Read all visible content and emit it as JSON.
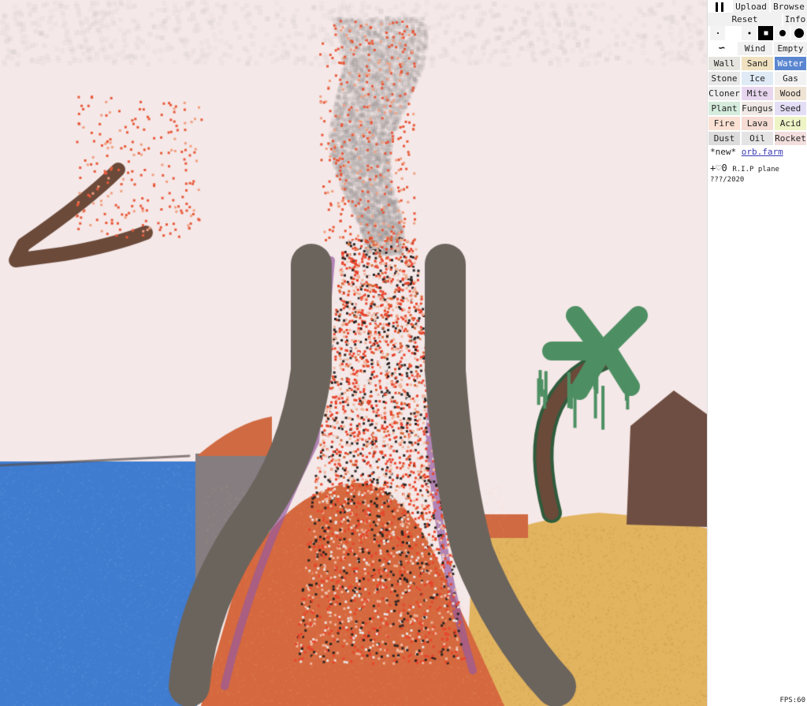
{
  "toolbar": {
    "pause_icon": "pause-icon",
    "upload": "Upload",
    "browse": "Browse",
    "reset": "Reset",
    "info": "Info",
    "wind": "Wind",
    "empty": "Empty",
    "brush_sizes": [
      "1",
      "2",
      "3",
      "4",
      "5"
    ],
    "selected_brush_index": 2
  },
  "elements": [
    {
      "label": "Wall",
      "color": "#e6e4de"
    },
    {
      "label": "Sand",
      "color": "#f0e2c0"
    },
    {
      "label": "Water",
      "color": "#5a86d0",
      "text": "#ffffff"
    },
    {
      "label": "Stone",
      "color": "#e8e8e8"
    },
    {
      "label": "Ice",
      "color": "#dfeaf6"
    },
    {
      "label": "Gas",
      "color": "#f2f2f2"
    },
    {
      "label": "Cloner",
      "color": "#eeeeee"
    },
    {
      "label": "Mite",
      "color": "#e8d6ef"
    },
    {
      "label": "Wood",
      "color": "#efe3d4"
    },
    {
      "label": "Plant",
      "color": "#d6ecdc"
    },
    {
      "label": "Fungus",
      "color": "#efe8e4"
    },
    {
      "label": "Seed",
      "color": "#e3def5"
    },
    {
      "label": "Fire",
      "color": "#fbe1d4"
    },
    {
      "label": "Lava",
      "color": "#f6dcd4"
    },
    {
      "label": "Acid",
      "color": "#eef4c6"
    },
    {
      "label": "Dust",
      "color": "#dcdcdc"
    },
    {
      "label": "Oil",
      "color": "#e4e4e4"
    },
    {
      "label": "Rocket",
      "color": "#f3dede"
    }
  ],
  "feed": {
    "new_tag": "*new*",
    "link": "orb.farm",
    "likes": "+♡0",
    "post_title": "R.I.P plane",
    "date": "???/2020"
  },
  "fps": "FPS:60",
  "colors": {
    "sky": "#f5e8e8",
    "smoke": "#b8b2b2",
    "water": "#3f7cd0",
    "lava_orange": "#d5683e",
    "volcano_wall": "#6b645d",
    "sand": "#e2b45f",
    "wood": "#6b4a3a",
    "leaf": "#4d8f63",
    "stone": "#857d80"
  }
}
